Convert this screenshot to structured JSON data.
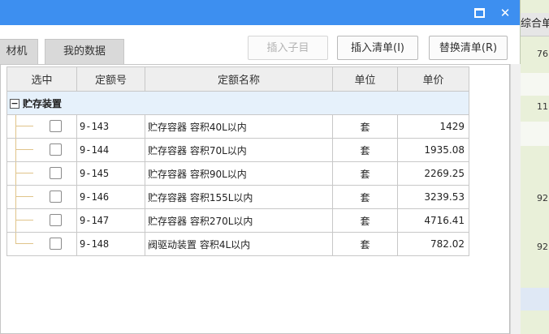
{
  "window": {
    "max_icon": "maximize-icon",
    "close_icon": "close-icon",
    "close_glyph": "✕"
  },
  "tabs": [
    {
      "label": "材机"
    },
    {
      "label": "我的数据"
    }
  ],
  "toolbar": {
    "insert_child": "插入子目",
    "insert_list": "插入清单(I)",
    "replace_list": "替换清单(R)"
  },
  "table": {
    "headers": {
      "select": "选中",
      "code": "定额号",
      "name": "定额名称",
      "unit": "单位",
      "price": "单价"
    },
    "group": {
      "expander": "−",
      "label": "贮存装置"
    },
    "rows": [
      {
        "code": "9-143",
        "name": "贮存容器 容积40L以内",
        "unit": "套",
        "price": "1429"
      },
      {
        "code": "9-144",
        "name": "贮存容器 容积70L以内",
        "unit": "套",
        "price": "1935.08"
      },
      {
        "code": "9-145",
        "name": "贮存容器 容积90L以内",
        "unit": "套",
        "price": "2269.25"
      },
      {
        "code": "9-146",
        "name": "贮存容器 容积155L以内",
        "unit": "套",
        "price": "3239.53"
      },
      {
        "code": "9-147",
        "name": "贮存容器 容积270L以内",
        "unit": "套",
        "price": "4716.41"
      },
      {
        "code": "9-148",
        "name": "阀驱动装置 容积4L以内",
        "unit": "套",
        "price": "782.02"
      }
    ]
  },
  "right_pane": {
    "header": "综合单",
    "values": [
      "76",
      "11",
      "92",
      "92"
    ]
  },
  "colors": {
    "titlebar": "#3d8ff0",
    "group_row": "#e6f1fb",
    "right_pane": "#e9f0d9"
  }
}
